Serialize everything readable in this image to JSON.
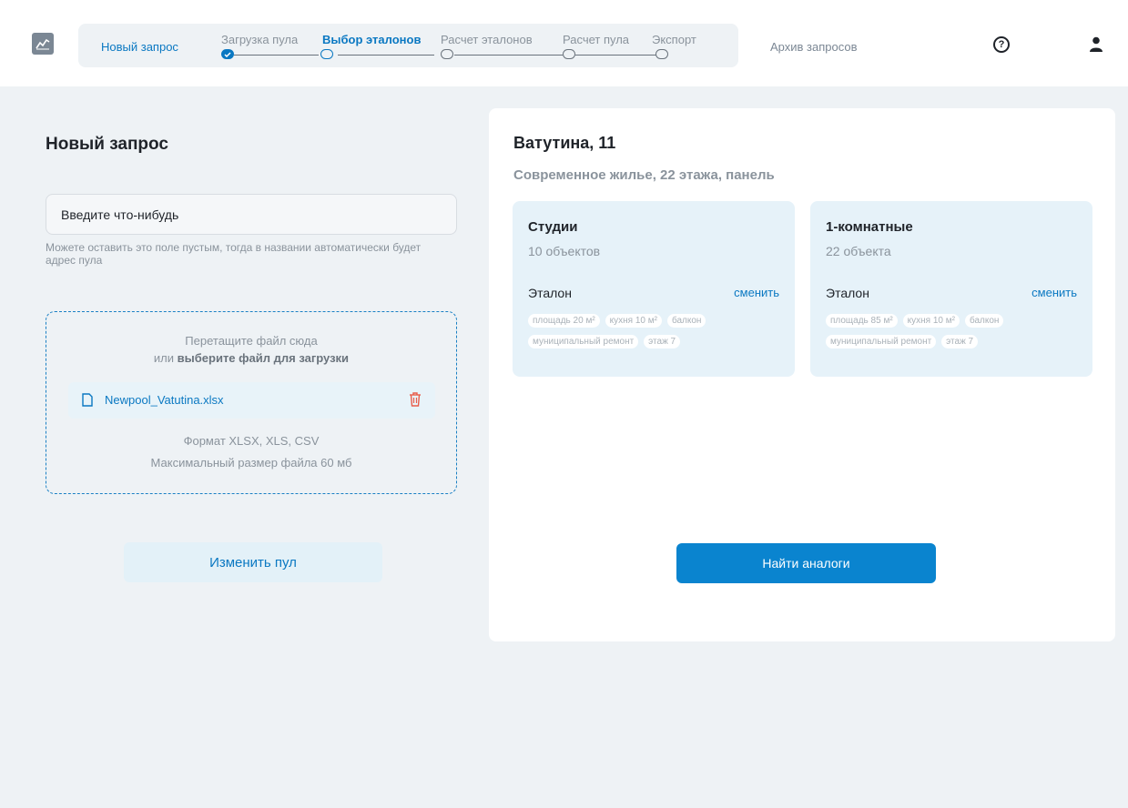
{
  "header": {
    "new_request": "Новый запрос",
    "steps": [
      {
        "label": "Загрузка пула",
        "state": "done"
      },
      {
        "label": "Выбор эталонов",
        "state": "active"
      },
      {
        "label": "Расчет эталонов",
        "state": "pending"
      },
      {
        "label": "Расчет пула",
        "state": "pending"
      },
      {
        "label": "Экспорт",
        "state": "pending"
      }
    ],
    "archive": "Архив запросов",
    "help_glyph": "?"
  },
  "left": {
    "title": "Новый запрос",
    "input_placeholder": "Введите что-нибудь",
    "hint": "Можете оставить это поле пустым, тогда в названии автоматически будет адрес пула",
    "dropzone": {
      "line1": "Перетащите файл сюда",
      "line2_prefix": "или ",
      "line2_bold": "выберите файл для загрузки",
      "file_name": "Newpool_Vatutina.xlsx",
      "format": "Формат XLSX, XLS, CSV",
      "max_size": "Максимальный размер файла 60 мб"
    },
    "change_pool": "Изменить пул"
  },
  "right": {
    "address": "Ватутина, 11",
    "description": "Современное жилье, 22 этажа, панель",
    "cards": [
      {
        "title": "Студии",
        "count": "10 объектов",
        "etalon_label": "Эталон",
        "change": "сменить",
        "tags": [
          "площадь 20 м²",
          "кухня 10 м²",
          "балкон",
          "муниципальный ремонт",
          "этаж 7"
        ]
      },
      {
        "title": "1-комнатные",
        "count": "22 объекта",
        "etalon_label": "Эталон",
        "change": "сменить",
        "tags": [
          "площадь 85 м²",
          "кухня 10 м²",
          "балкон",
          "муниципальный ремонт",
          "этаж 7"
        ]
      }
    ],
    "find_button": "Найти аналоги"
  },
  "colors": {
    "accent": "#0a78c2",
    "button_primary": "#0a84cf",
    "card_bg": "#e6f2f9",
    "page_bg": "#eef2f5"
  }
}
